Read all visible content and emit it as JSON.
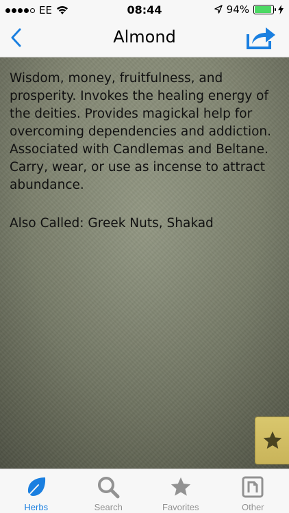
{
  "status_bar": {
    "carrier": "EE",
    "time": "08:44",
    "battery": "94%"
  },
  "nav": {
    "title": "Almond"
  },
  "herb": {
    "description": "Wisdom, money, fruitfulness, and prosperity. Invokes the healing energy of the deities. Provides magickal help for overcoming dependencies and addiction. Associated with Candlemas and Beltane. Carry, wear, or use as incense to attract abundance.",
    "also_called": "Also Called: Greek Nuts, Shakad"
  },
  "tabs": [
    {
      "label": "Herbs",
      "icon": "leaf-icon",
      "active": true
    },
    {
      "label": "Search",
      "icon": "search-icon",
      "active": false
    },
    {
      "label": "Favorites",
      "icon": "star-icon",
      "active": false
    },
    {
      "label": "Other",
      "icon": "other-icon",
      "active": false
    }
  ],
  "colors": {
    "accent": "#1a7fe0",
    "inactive": "#929292",
    "favorite_bg": "#d4c164",
    "battery": "#4cd964"
  }
}
